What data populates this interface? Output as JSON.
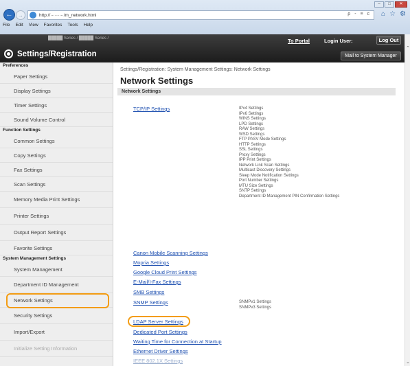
{
  "browser": {
    "address": "http://·········/m_network.html",
    "address_controls": "ρ - ≡ c",
    "menu": [
      "File",
      "Edit",
      "View",
      "Favorites",
      "Tools",
      "Help"
    ]
  },
  "header": {
    "model": "█████ Series / █████ Series /",
    "title": "Settings/Registration",
    "to_portal": "To Portal",
    "login_user": "Login User:",
    "log_out": "Log Out",
    "mail_to_manager": "Mail to System Manager"
  },
  "sidebar": {
    "sections": [
      {
        "heading": "Preferences",
        "items": [
          "Paper Settings",
          "Display Settings",
          "Timer Settings",
          "Sound Volume Control"
        ]
      },
      {
        "heading": "Function Settings",
        "items": [
          "Common Settings",
          "Copy Settings",
          "Fax Settings",
          "Scan Settings",
          "Memory Media Print Settings",
          "Printer Settings",
          "Output Report Settings",
          "Favorite Settings"
        ]
      },
      {
        "heading": "System Management Settings",
        "items": [
          "System Management",
          "Department ID Management",
          "Network Settings",
          "Security Settings",
          "Import/Export",
          "Initialize Setting Information"
        ]
      }
    ]
  },
  "main": {
    "breadcrumb": "Settings/Registration: System Management Settings: Network Settings",
    "title": "Network Settings",
    "section_header": "Network Settings",
    "links": [
      {
        "label": "TCP/IP Settings",
        "subs": [
          "IPv4 Settings",
          "IPv6 Settings",
          "WINS Settings",
          "LPD Settings",
          "RAW Settings",
          "WSD Settings",
          "FTP PASV Mode Settings",
          "HTTP Settings",
          "SSL Settings",
          "Proxy Settings",
          "IPP Print Settings",
          "Network Link Scan Settings",
          "Multicast Discovery Settings",
          "Sleep Mode Notification Settings",
          "Port Number Settings",
          "MTU Size Settings",
          "SNTP Settings",
          "Department ID Management PIN Confirmation Settings"
        ]
      },
      {
        "label": "Canon Mobile Scanning Settings",
        "subs": []
      },
      {
        "label": "Mopria Settings",
        "subs": []
      },
      {
        "label": "Google Cloud Print Settings",
        "subs": []
      },
      {
        "label": "E-Mail/I-Fax Settings",
        "subs": []
      },
      {
        "label": "SMB Settings",
        "subs": []
      },
      {
        "label": "SNMP Settings",
        "subs": [
          "SNMPv1 Settings",
          "SNMPv3 Settings"
        ]
      },
      {
        "label": "LDAP Server Settings",
        "subs": []
      },
      {
        "label": "Dedicated Port Settings",
        "subs": []
      },
      {
        "label": "Waiting Time for Connection at Startup",
        "subs": []
      },
      {
        "label": "Ethernet Driver Settings",
        "subs": []
      },
      {
        "label": "IEEE 802.1X Settings",
        "subs": []
      }
    ]
  }
}
